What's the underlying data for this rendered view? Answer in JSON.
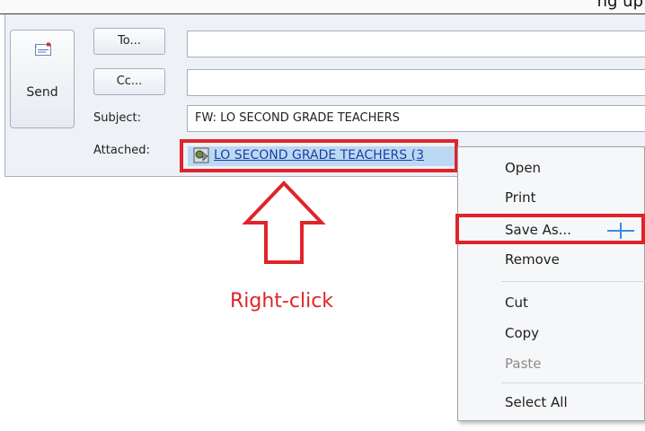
{
  "header": {
    "partial_text": "ng up"
  },
  "send": {
    "label": "Send"
  },
  "fields": {
    "to_label": "To...",
    "cc_label": "Cc...",
    "subject_label": "Subject:",
    "subject_value": "FW: LO SECOND GRADE TEACHERS",
    "attached_label": "Attached:",
    "attachment_name": "LO SECOND GRADE TEACHERS (3"
  },
  "annotation": {
    "caption": "Right-click",
    "accent_color": "#e0242b"
  },
  "context_menu": {
    "items": [
      {
        "label": "Open",
        "enabled": true
      },
      {
        "label": "Print",
        "enabled": true
      },
      {
        "label": "Save As...",
        "enabled": true,
        "highlighted": true
      },
      {
        "label": "Remove",
        "enabled": true
      },
      {
        "label": "Cut",
        "enabled": true
      },
      {
        "label": "Copy",
        "enabled": true
      },
      {
        "label": "Paste",
        "enabled": false
      },
      {
        "label": "Select All",
        "enabled": true
      }
    ]
  },
  "icons": [
    "send-mail-icon",
    "attachment-file-icon",
    "up-arrow-icon",
    "cursor-crosshair-icon"
  ]
}
